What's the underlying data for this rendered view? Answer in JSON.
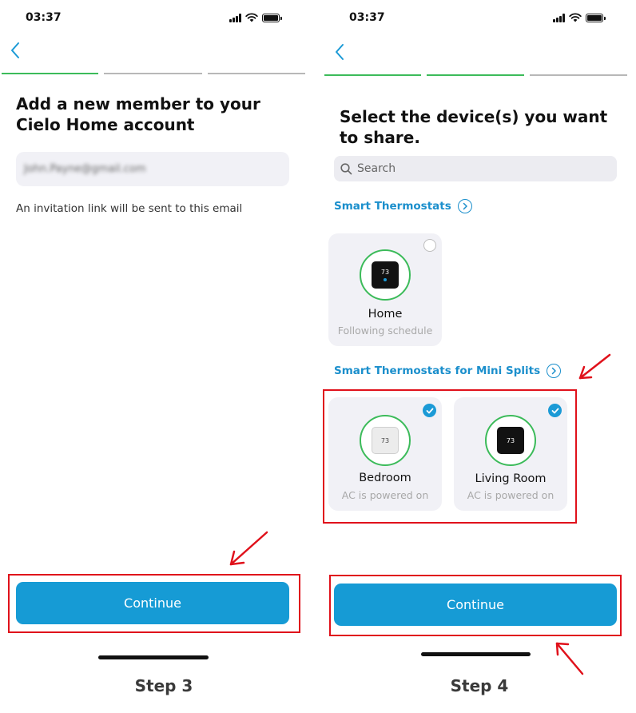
{
  "left": {
    "status_time": "03:37",
    "title": "Add a new member to your Cielo Home account",
    "email_value": "John.Payne@gmail.com",
    "hint": "An invitation link will be sent to this email",
    "continue_label": "Continue",
    "step_label": "Step 3",
    "progress_done": 1,
    "progress_total": 3
  },
  "right": {
    "status_time": "03:37",
    "title": "Select the device(s) you want to share.",
    "search_placeholder": "Search",
    "group1": {
      "title": "Smart Thermostats",
      "devices": [
        {
          "name": "Home",
          "status": "Following schedule",
          "display": "73",
          "selected": false
        }
      ]
    },
    "group2": {
      "title": "Smart Thermostats for Mini Splits",
      "devices": [
        {
          "name": "Bedroom",
          "status": "AC is powered on",
          "display": "73",
          "selected": true
        },
        {
          "name": "Living Room",
          "status": "AC is powered on",
          "display": "73",
          "selected": true
        }
      ]
    },
    "continue_label": "Continue",
    "step_label": "Step 4",
    "progress_done": 2,
    "progress_total": 3
  },
  "colors": {
    "accent": "#169bd5",
    "progress_done": "#3cbb5a",
    "highlight": "#e0111b"
  }
}
